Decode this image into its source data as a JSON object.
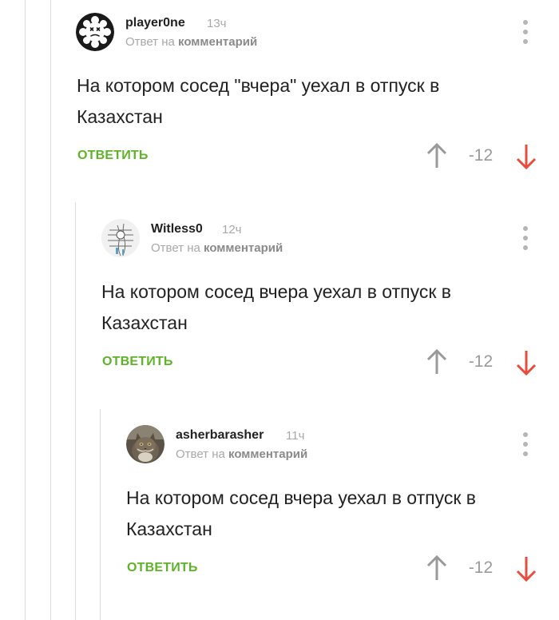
{
  "colors": {
    "accent_green": "#5eb328",
    "downvote_red": "#e74c3c",
    "muted_gray": "#a8a8a8",
    "thread_line": "#dcdcdc"
  },
  "comments": [
    {
      "username": "player0ne",
      "time": "13ч",
      "reply_prefix": "Ответ на",
      "reply_target": "комментарий",
      "text": "На котором сосед \"вчера\" уехал в отпуск в Казахстан",
      "reply_label": "ОТВЕТИТЬ",
      "rating": "-12",
      "avatar_icon": "snowflake-skull-avatar",
      "menu_icon": "more-vertical-icon",
      "upvote_icon": "arrow-up-icon",
      "downvote_icon": "arrow-down-icon"
    },
    {
      "username": "Witless0",
      "time": "12ч",
      "reply_prefix": "Ответ на",
      "reply_target": "комментарий",
      "text": "На котором сосед вчера уехал в отпуск в Казахстан",
      "reply_label": "ОТВЕТИТЬ",
      "rating": "-12",
      "avatar_icon": "sketch-avatar",
      "menu_icon": "more-vertical-icon",
      "upvote_icon": "arrow-up-icon",
      "downvote_icon": "arrow-down-icon"
    },
    {
      "username": "asherbarasher",
      "time": "11ч",
      "reply_prefix": "Ответ на",
      "reply_target": "комментарий",
      "text": "На котором сосед вчера уехал в отпуск в Казахстан",
      "reply_label": "ОТВЕТИТЬ",
      "rating": "-12",
      "avatar_icon": "cat-photo-avatar",
      "menu_icon": "more-vertical-icon",
      "upvote_icon": "arrow-up-icon",
      "downvote_icon": "arrow-down-icon"
    }
  ]
}
